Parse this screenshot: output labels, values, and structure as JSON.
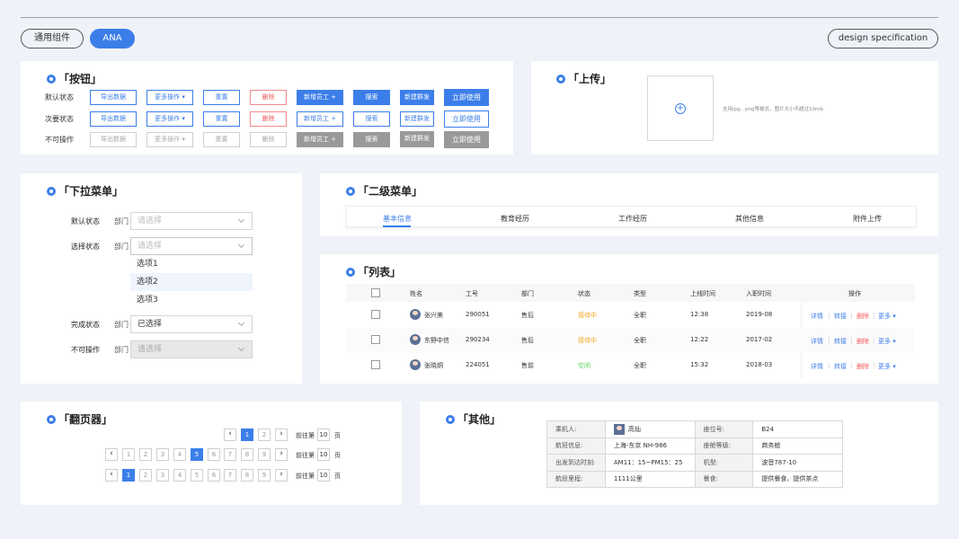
{
  "header": {
    "pill_common": "通用组件",
    "pill_ana": "ANA",
    "pill_spec": "design specification"
  },
  "colors": {
    "accent": "#3c7ee9",
    "danger": "#f05a5a",
    "background": "#eff2f9"
  },
  "buttons_card": {
    "title": "「按钮」",
    "rows": [
      "默认状态",
      "次要状态",
      "不可操作"
    ],
    "labels": {
      "export": "导出数据",
      "more": "更多操作 ▾",
      "reset": "重置",
      "delete": "删除",
      "add_employee": "新增员工 +",
      "search": "搜索",
      "new_group": "新建群发",
      "use_now": "立即使用"
    }
  },
  "upload_card": {
    "title": "「上传」",
    "plus": "+",
    "hint": "支持jpg、png等格式，图片大小不超过10mb"
  },
  "dropdown_card": {
    "title": "「下拉菜单」",
    "dept": "部门",
    "rows": {
      "default_label": "默认状态",
      "selected_label": "选择状态",
      "done_label": "完成状态",
      "disabled_label": "不可操作"
    },
    "placeholder": "请选择",
    "options": [
      "选项1",
      "选项2",
      "选项3"
    ],
    "done_value": "已选择"
  },
  "submenu_card": {
    "title": "「二级菜单」",
    "tabs": [
      "基本信息",
      "教育经历",
      "工作经历",
      "其他信息",
      "附件上传"
    ]
  },
  "list_card": {
    "title": "「列表」",
    "headers": [
      "姓名",
      "工号",
      "部门",
      "状态",
      "类型",
      "上线时间",
      "入职时间",
      "操作"
    ],
    "rows": [
      {
        "name": "张兴美",
        "id": "290051",
        "dept": "售后",
        "status": "接待中",
        "type": "全职",
        "online": "12:38",
        "join": "2019-08"
      },
      {
        "name": "东野中信",
        "id": "290234",
        "dept": "售后",
        "status": "接待中",
        "type": "全职",
        "online": "12:22",
        "join": "2017-02"
      },
      {
        "name": "张晓炯",
        "id": "224051",
        "dept": "售前",
        "status": "空闲",
        "type": "全职",
        "online": "15:32",
        "join": "2018-03"
      }
    ],
    "ops": {
      "detail": "详情",
      "transfer": "转接",
      "delete": "删除",
      "more": "更多 ▾",
      "sep": "|"
    },
    "status_colors": {
      "busy": "#f5a623",
      "idle": "#5ad05a"
    }
  },
  "pager_card": {
    "title": "「翻页器」",
    "prev": "‹",
    "next": "›",
    "goto_prefix": "前往第",
    "goto_value": "10",
    "goto_suffix": "页",
    "row1": [
      "1",
      "2"
    ],
    "row2": [
      "1",
      "2",
      "3",
      "4",
      "5",
      "6",
      "7",
      "8",
      "9"
    ],
    "row3": [
      "1",
      "2",
      "3",
      "4",
      "5",
      "6",
      "7",
      "8",
      "9"
    ]
  },
  "other_card": {
    "title": "「其他」",
    "rows": [
      [
        "乘机人:",
        "高灿",
        "座位号:",
        "B24"
      ],
      [
        "航班信息:",
        "上海-东京 NH-986",
        "座舱等级:",
        "商务舱"
      ],
      [
        "出发到达时刻:",
        "AM11：15~PM15：25",
        "机型:",
        "波音787-10"
      ],
      [
        "航段里程:",
        "1111公里",
        "餐食:",
        "提供餐食、提供茶点"
      ]
    ]
  }
}
